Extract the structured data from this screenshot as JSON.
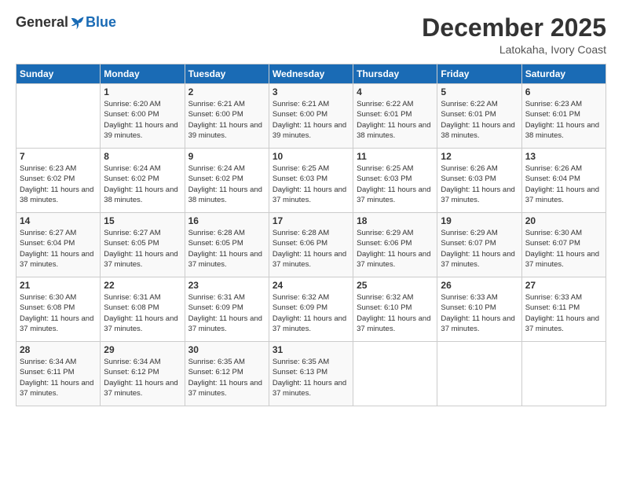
{
  "header": {
    "logo": {
      "general": "General",
      "blue": "Blue",
      "tagline": ""
    },
    "title": "December 2025",
    "location": "Latokaha, Ivory Coast"
  },
  "calendar": {
    "days_of_week": [
      "Sunday",
      "Monday",
      "Tuesday",
      "Wednesday",
      "Thursday",
      "Friday",
      "Saturday"
    ],
    "weeks": [
      [
        {
          "day": "",
          "sunrise": "",
          "sunset": "",
          "daylight": ""
        },
        {
          "day": "1",
          "sunrise": "Sunrise: 6:20 AM",
          "sunset": "Sunset: 6:00 PM",
          "daylight": "Daylight: 11 hours and 39 minutes."
        },
        {
          "day": "2",
          "sunrise": "Sunrise: 6:21 AM",
          "sunset": "Sunset: 6:00 PM",
          "daylight": "Daylight: 11 hours and 39 minutes."
        },
        {
          "day": "3",
          "sunrise": "Sunrise: 6:21 AM",
          "sunset": "Sunset: 6:00 PM",
          "daylight": "Daylight: 11 hours and 39 minutes."
        },
        {
          "day": "4",
          "sunrise": "Sunrise: 6:22 AM",
          "sunset": "Sunset: 6:01 PM",
          "daylight": "Daylight: 11 hours and 38 minutes."
        },
        {
          "day": "5",
          "sunrise": "Sunrise: 6:22 AM",
          "sunset": "Sunset: 6:01 PM",
          "daylight": "Daylight: 11 hours and 38 minutes."
        },
        {
          "day": "6",
          "sunrise": "Sunrise: 6:23 AM",
          "sunset": "Sunset: 6:01 PM",
          "daylight": "Daylight: 11 hours and 38 minutes."
        }
      ],
      [
        {
          "day": "7",
          "sunrise": "Sunrise: 6:23 AM",
          "sunset": "Sunset: 6:02 PM",
          "daylight": "Daylight: 11 hours and 38 minutes."
        },
        {
          "day": "8",
          "sunrise": "Sunrise: 6:24 AM",
          "sunset": "Sunset: 6:02 PM",
          "daylight": "Daylight: 11 hours and 38 minutes."
        },
        {
          "day": "9",
          "sunrise": "Sunrise: 6:24 AM",
          "sunset": "Sunset: 6:02 PM",
          "daylight": "Daylight: 11 hours and 38 minutes."
        },
        {
          "day": "10",
          "sunrise": "Sunrise: 6:25 AM",
          "sunset": "Sunset: 6:03 PM",
          "daylight": "Daylight: 11 hours and 37 minutes."
        },
        {
          "day": "11",
          "sunrise": "Sunrise: 6:25 AM",
          "sunset": "Sunset: 6:03 PM",
          "daylight": "Daylight: 11 hours and 37 minutes."
        },
        {
          "day": "12",
          "sunrise": "Sunrise: 6:26 AM",
          "sunset": "Sunset: 6:03 PM",
          "daylight": "Daylight: 11 hours and 37 minutes."
        },
        {
          "day": "13",
          "sunrise": "Sunrise: 6:26 AM",
          "sunset": "Sunset: 6:04 PM",
          "daylight": "Daylight: 11 hours and 37 minutes."
        }
      ],
      [
        {
          "day": "14",
          "sunrise": "Sunrise: 6:27 AM",
          "sunset": "Sunset: 6:04 PM",
          "daylight": "Daylight: 11 hours and 37 minutes."
        },
        {
          "day": "15",
          "sunrise": "Sunrise: 6:27 AM",
          "sunset": "Sunset: 6:05 PM",
          "daylight": "Daylight: 11 hours and 37 minutes."
        },
        {
          "day": "16",
          "sunrise": "Sunrise: 6:28 AM",
          "sunset": "Sunset: 6:05 PM",
          "daylight": "Daylight: 11 hours and 37 minutes."
        },
        {
          "day": "17",
          "sunrise": "Sunrise: 6:28 AM",
          "sunset": "Sunset: 6:06 PM",
          "daylight": "Daylight: 11 hours and 37 minutes."
        },
        {
          "day": "18",
          "sunrise": "Sunrise: 6:29 AM",
          "sunset": "Sunset: 6:06 PM",
          "daylight": "Daylight: 11 hours and 37 minutes."
        },
        {
          "day": "19",
          "sunrise": "Sunrise: 6:29 AM",
          "sunset": "Sunset: 6:07 PM",
          "daylight": "Daylight: 11 hours and 37 minutes."
        },
        {
          "day": "20",
          "sunrise": "Sunrise: 6:30 AM",
          "sunset": "Sunset: 6:07 PM",
          "daylight": "Daylight: 11 hours and 37 minutes."
        }
      ],
      [
        {
          "day": "21",
          "sunrise": "Sunrise: 6:30 AM",
          "sunset": "Sunset: 6:08 PM",
          "daylight": "Daylight: 11 hours and 37 minutes."
        },
        {
          "day": "22",
          "sunrise": "Sunrise: 6:31 AM",
          "sunset": "Sunset: 6:08 PM",
          "daylight": "Daylight: 11 hours and 37 minutes."
        },
        {
          "day": "23",
          "sunrise": "Sunrise: 6:31 AM",
          "sunset": "Sunset: 6:09 PM",
          "daylight": "Daylight: 11 hours and 37 minutes."
        },
        {
          "day": "24",
          "sunrise": "Sunrise: 6:32 AM",
          "sunset": "Sunset: 6:09 PM",
          "daylight": "Daylight: 11 hours and 37 minutes."
        },
        {
          "day": "25",
          "sunrise": "Sunrise: 6:32 AM",
          "sunset": "Sunset: 6:10 PM",
          "daylight": "Daylight: 11 hours and 37 minutes."
        },
        {
          "day": "26",
          "sunrise": "Sunrise: 6:33 AM",
          "sunset": "Sunset: 6:10 PM",
          "daylight": "Daylight: 11 hours and 37 minutes."
        },
        {
          "day": "27",
          "sunrise": "Sunrise: 6:33 AM",
          "sunset": "Sunset: 6:11 PM",
          "daylight": "Daylight: 11 hours and 37 minutes."
        }
      ],
      [
        {
          "day": "28",
          "sunrise": "Sunrise: 6:34 AM",
          "sunset": "Sunset: 6:11 PM",
          "daylight": "Daylight: 11 hours and 37 minutes."
        },
        {
          "day": "29",
          "sunrise": "Sunrise: 6:34 AM",
          "sunset": "Sunset: 6:12 PM",
          "daylight": "Daylight: 11 hours and 37 minutes."
        },
        {
          "day": "30",
          "sunrise": "Sunrise: 6:35 AM",
          "sunset": "Sunset: 6:12 PM",
          "daylight": "Daylight: 11 hours and 37 minutes."
        },
        {
          "day": "31",
          "sunrise": "Sunrise: 6:35 AM",
          "sunset": "Sunset: 6:13 PM",
          "daylight": "Daylight: 11 hours and 37 minutes."
        },
        {
          "day": "",
          "sunrise": "",
          "sunset": "",
          "daylight": ""
        },
        {
          "day": "",
          "sunrise": "",
          "sunset": "",
          "daylight": ""
        },
        {
          "day": "",
          "sunrise": "",
          "sunset": "",
          "daylight": ""
        }
      ]
    ]
  }
}
